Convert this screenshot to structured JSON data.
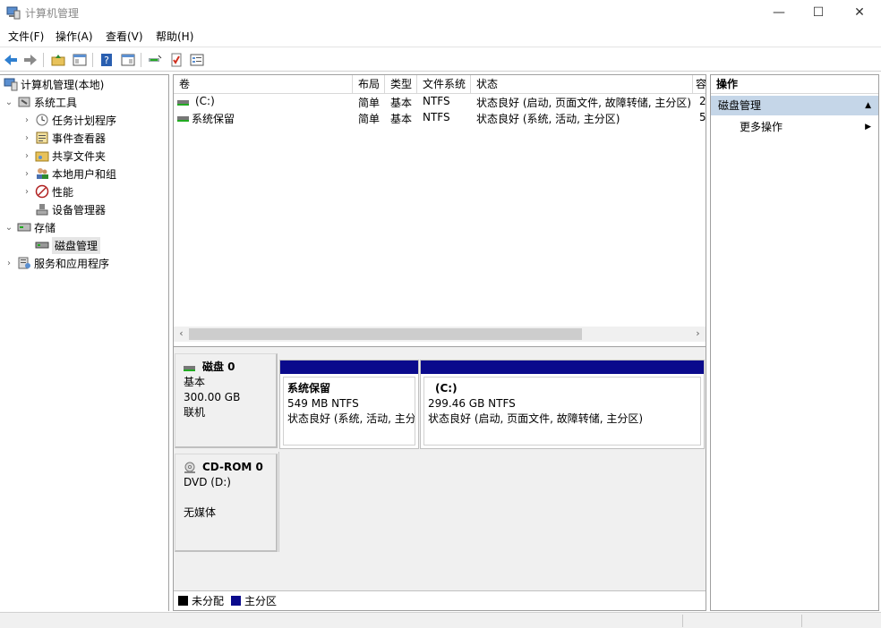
{
  "window": {
    "title": "计算机管理",
    "minimize_glyph": "—",
    "maximize_glyph": "☐",
    "close_glyph": "✕"
  },
  "menubar": {
    "items": [
      "文件(F)",
      "操作(A)",
      "查看(V)",
      "帮助(H)"
    ]
  },
  "toolbar": {
    "icons": [
      "back-icon",
      "forward-icon",
      "up-folder-icon",
      "show-hide-tree-icon",
      "help-icon",
      "show-hide-action-pane-icon",
      "connect-icon",
      "check-icon",
      "properties-icon"
    ]
  },
  "tree": {
    "root": "计算机管理(本地)",
    "system_tools": "系统工具",
    "task_scheduler": "任务计划程序",
    "event_viewer": "事件查看器",
    "shared_folders": "共享文件夹",
    "local_users": "本地用户和组",
    "performance": "性能",
    "device_manager": "设备管理器",
    "storage": "存储",
    "disk_management": "磁盘管理",
    "services_apps": "服务和应用程序"
  },
  "volume_list": {
    "columns": [
      "卷",
      "布局",
      "类型",
      "文件系统",
      "状态",
      "容"
    ],
    "rows": [
      {
        "volume": "(C:)",
        "layout": "简单",
        "type": "基本",
        "fs": "NTFS",
        "status": "状态良好 (启动, 页面文件, 故障转储, 主分区)",
        "cap": "2"
      },
      {
        "volume": "系统保留",
        "layout": "简单",
        "type": "基本",
        "fs": "NTFS",
        "status": "状态良好 (系统, 活动, 主分区)",
        "cap": "5"
      }
    ],
    "scroll_left": "‹",
    "scroll_right": "›"
  },
  "disks": {
    "disk0": {
      "name": "磁盘 0",
      "type": "基本",
      "size": "300.00 GB",
      "state": "联机",
      "partitions": [
        {
          "name": "系统保留",
          "size": "549 MB NTFS",
          "status": "状态良好 (系统, 活动, 主分区"
        },
        {
          "name": "(C:)",
          "size": "299.46 GB NTFS",
          "status": "状态良好 (启动, 页面文件, 故障转储, 主分区)"
        }
      ]
    },
    "cdrom0": {
      "name": "CD-ROM 0",
      "drive": "DVD (D:)",
      "media": "无媒体"
    }
  },
  "legend": {
    "unallocated": "未分配",
    "primary": "主分区",
    "unallocated_color": "#000000",
    "primary_color": "#0a0a8c"
  },
  "actions": {
    "header": "操作",
    "section": "磁盘管理",
    "section_arrow": "▲",
    "more": "更多操作",
    "more_arrow": "▶"
  },
  "colors": {
    "partition_bar": "#0a0a8c",
    "action_section_bg": "#c5d6e8"
  }
}
